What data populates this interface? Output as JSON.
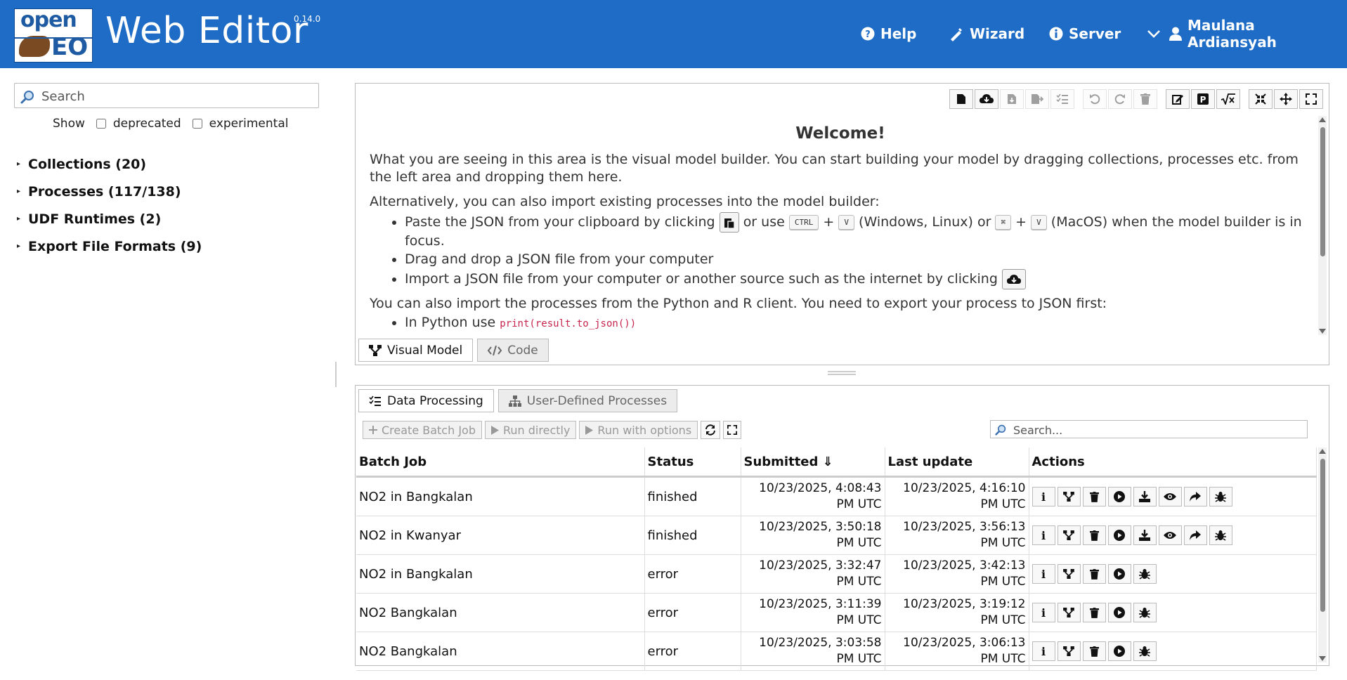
{
  "header": {
    "logo_top": "open",
    "logo_bottom": "EO",
    "title": "Web Editor",
    "version": "0.14.0",
    "nav": {
      "help": "Help",
      "wizard": "Wizard",
      "server": "Server",
      "user": "Maulana Ardiansyah"
    }
  },
  "sidebar": {
    "search_placeholder": "Search",
    "show_label": "Show",
    "deprecated_label": "deprecated",
    "experimental_label": "experimental",
    "items": [
      {
        "label": "Collections (20)"
      },
      {
        "label": "Processes (117/138)"
      },
      {
        "label": "UDF Runtimes (2)"
      },
      {
        "label": "Export File Formats (9)"
      }
    ]
  },
  "model_builder": {
    "welcome_title": "Welcome!",
    "p1": "What you are seeing in this area is the visual model builder. You can start building your model by dragging collections, processes etc. from the left area and dropping them here.",
    "p2": "Alternatively, you can also import existing processes into the model builder:",
    "b1_a": "Paste the JSON from your clipboard by clicking",
    "b1_b": "or use",
    "key_ctrl": "CTRL",
    "plus": "+",
    "key_v": "V",
    "b1_c": "(Windows, Linux) or",
    "key_cmd": "⌘",
    "b1_d": "(MacOS) when the model builder is in focus.",
    "b2": "Drag and drop a JSON file from your computer",
    "b3": "Import a JSON file from your computer or another source such as the internet by clicking",
    "p3": "You can also import the processes from the Python and R client. You need to export your process to JSON first:",
    "b4": "In Python use",
    "b4_code": "print(result.to_json())",
    "tab_visual": "Visual Model",
    "tab_code": "Code"
  },
  "data_processing": {
    "tab_dp": "Data Processing",
    "tab_udp": "User-Defined Processes",
    "btn_create": "Create Batch Job",
    "btn_run": "Run directly",
    "btn_run_opts": "Run with options",
    "search_placeholder": "Search...",
    "columns": [
      "Batch Job",
      "Status",
      "Submitted ⇓",
      "Last update",
      "Actions"
    ],
    "rows": [
      {
        "name": "NO2 in Bangkalan",
        "status": "finished",
        "submitted_1": "10/23/2025, 4:08:43",
        "submitted_2": "PM UTC",
        "updated_1": "10/23/2025, 4:16:10",
        "updated_2": "PM UTC"
      },
      {
        "name": "NO2 in Kwanyar",
        "status": "finished",
        "submitted_1": "10/23/2025, 3:50:18",
        "submitted_2": "PM UTC",
        "updated_1": "10/23/2025, 3:56:13",
        "updated_2": "PM UTC"
      },
      {
        "name": "NO2 in Bangkalan",
        "status": "error",
        "submitted_1": "10/23/2025, 3:32:47",
        "submitted_2": "PM UTC",
        "updated_1": "10/23/2025, 3:42:13",
        "updated_2": "PM UTC"
      },
      {
        "name": "NO2 Bangkalan",
        "status": "error",
        "submitted_1": "10/23/2025, 3:11:39",
        "submitted_2": "PM UTC",
        "updated_1": "10/23/2025, 3:19:12",
        "updated_2": "PM UTC"
      },
      {
        "name": "NO2 Bangkalan",
        "status": "error",
        "submitted_1": "10/23/2025, 3:03:58",
        "submitted_2": "PM UTC",
        "updated_1": "10/23/2025, 3:06:13",
        "updated_2": "PM UTC"
      }
    ],
    "info_icon_letter": "i"
  },
  "colors": {
    "header_bg": "#1e6cc5",
    "status_finished": "#006600",
    "status_error": "#cc0000"
  }
}
